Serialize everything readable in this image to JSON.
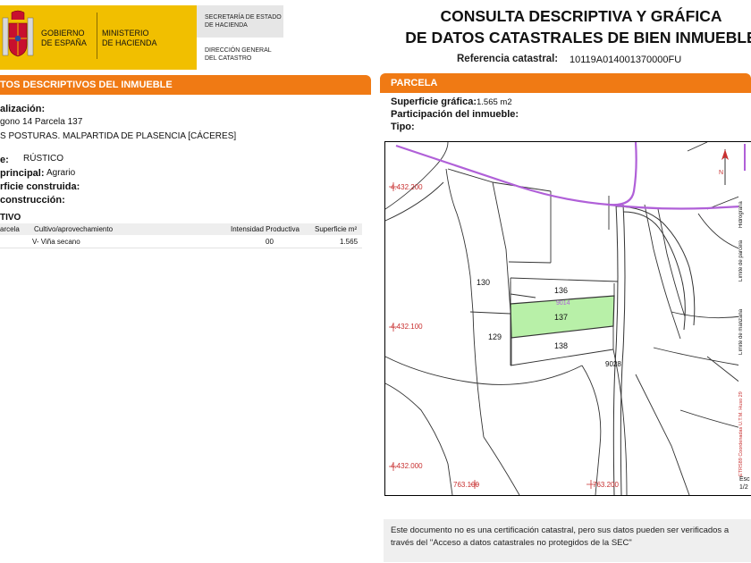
{
  "header": {
    "logo_line1": "GOBIERNO",
    "logo_line2": "DE ESPAÑA",
    "ministry_line1": "MINISTERIO",
    "ministry_line2": "DE HACIENDA",
    "secretaria_line1": "SECRETARÍA DE ESTADO",
    "secretaria_line2": "DE HACIENDA",
    "direccion_line1": "DIRECCIÓN GENERAL",
    "direccion_line2": "DEL CATASTRO",
    "title_line1": "CONSULTA DESCRIPTIVA Y GRÁFICA",
    "title_line2": "DE DATOS CATASTRALES DE BIEN INMUEBLE",
    "ref_label": "Referencia catastral:",
    "ref_value": "10119A014001370000FU",
    "brand_yellow": "#f1bf00",
    "accent_orange": "#f07a14"
  },
  "left": {
    "section_title": "TOS DESCRIPTIVOS DEL INMUEBLE",
    "localizacion_label": "alización:",
    "localizacion_line1": "gono 14 Parcela 137",
    "localizacion_line2": "S POSTURAS. MALPARTIDA DE PLASENCIA [CÁCERES]",
    "clase_label": "e:",
    "clase_value": "RÚSTICO",
    "uso_label": "principal:",
    "uso_value": "Agrario",
    "superficie_label": "rficie construida:",
    "construccion_label": "construcción:",
    "cultivo_title": "TIVO",
    "cultivo_headers": [
      "arcela",
      "Cultivo/aprovechamiento",
      "Intensidad Productiva",
      "Superficie m²"
    ],
    "cultivo_row": [
      "V- Viña secano",
      "00",
      "1.565"
    ]
  },
  "right": {
    "section_title": "PARCELA",
    "superficie_label": "Superficie gráfica:",
    "superficie_value": "1.565 m2",
    "participacion_label": "Participación del inmueble:",
    "tipo_label": "Tipo:",
    "map": {
      "coord_y1": "4.432.200",
      "coord_y2": "4.432.100",
      "coord_y3": "4.432.000",
      "coord_x1": "763.100",
      "coord_x2": "763.200",
      "parcel_130": "130",
      "parcel_136": "136",
      "parcel_137": "137",
      "parcel_138": "138",
      "parcel_129": "129",
      "parcel_9028": "9028",
      "parcel_9014": "9014",
      "highlight_fill": "#b8f0a8",
      "hydro_color": "#b060d8"
    },
    "legend": {
      "hidrografia": "Hidrografía",
      "limite_parcela": "Límite de parcela",
      "limite_manzana": "Límite de manzana",
      "coord_note": "ETRS89 Coordenadas U.T.M. Huso 29",
      "escala_label": "Esc",
      "escala_value": "1/2"
    },
    "footer_note": "Este documento no es una certificación catastral, pero sus datos pueden ser verificados a través del \"Acceso a datos catastrales no protegidos de la SEC\""
  }
}
